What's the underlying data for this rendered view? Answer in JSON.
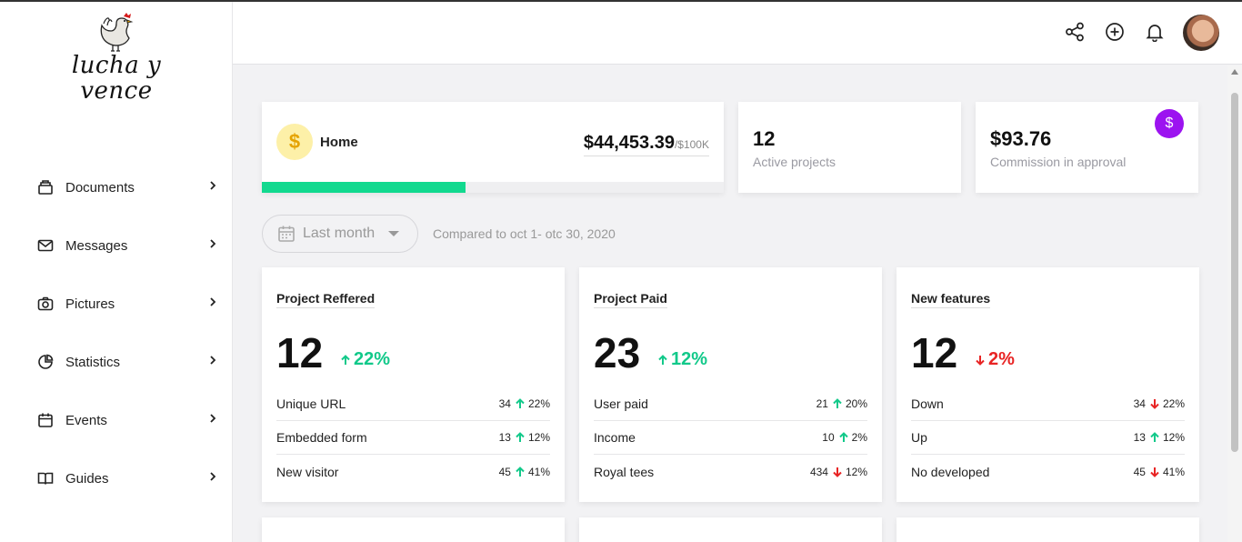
{
  "brand": {
    "line1": "lucha y",
    "line2": "vence"
  },
  "sidebar": {
    "items": [
      {
        "label": "Documents",
        "icon": "archive-icon"
      },
      {
        "label": "Messages",
        "icon": "mail-icon"
      },
      {
        "label": "Pictures",
        "icon": "camera-icon"
      },
      {
        "label": "Statistics",
        "icon": "pie-chart-icon"
      },
      {
        "label": "Events",
        "icon": "calendar-icon"
      },
      {
        "label": "Guides",
        "icon": "book-icon"
      }
    ]
  },
  "header": {
    "icons": [
      "share-icon",
      "add-circle-icon",
      "bell-icon"
    ]
  },
  "home": {
    "label": "Home",
    "amount": "$44,453.39",
    "target": "/$100K",
    "progress": 0.44
  },
  "stats": [
    {
      "value": "12",
      "label": "Active projects"
    },
    {
      "value": "$93.76",
      "label": "Commission in approval"
    }
  ],
  "filter": {
    "selected": "Last month",
    "compare_text": "Compared to oct 1- otc 30, 2020"
  },
  "metrics": [
    {
      "title": "Project Reffered",
      "value": "12",
      "change": "22%",
      "direction": "up",
      "rows": [
        {
          "label": "Unique URL",
          "count": "34",
          "pct": "22%",
          "direction": "up"
        },
        {
          "label": "Embedded form",
          "count": "13",
          "pct": "12%",
          "direction": "up"
        },
        {
          "label": "New visitor",
          "count": "45",
          "pct": "41%",
          "direction": "up"
        }
      ]
    },
    {
      "title": "Project Paid",
      "value": "23",
      "change": "12%",
      "direction": "up",
      "rows": [
        {
          "label": "User paid",
          "count": "21",
          "pct": "20%",
          "direction": "up"
        },
        {
          "label": "Income",
          "count": "10",
          "pct": "2%",
          "direction": "up"
        },
        {
          "label": "Royal tees",
          "count": "434",
          "pct": "12%",
          "direction": "down"
        }
      ]
    },
    {
      "title": "New features",
      "value": "12",
      "change": "2%",
      "direction": "down",
      "rows": [
        {
          "label": "Down",
          "count": "34",
          "pct": "22%",
          "direction": "down"
        },
        {
          "label": "Up",
          "count": "13",
          "pct": "12%",
          "direction": "up"
        },
        {
          "label": "No developed",
          "count": "45",
          "pct": "41%",
          "direction": "down"
        }
      ]
    }
  ],
  "colors": {
    "up": "#12c98a",
    "down": "#e82424",
    "progress": "#12d98f",
    "badge": "#9c13f0"
  }
}
